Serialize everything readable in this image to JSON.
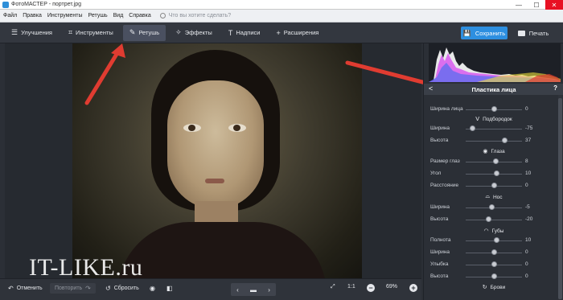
{
  "window": {
    "title": "ФотоМАСТЕР - портрет.jpg",
    "controls": [
      "—",
      "☐",
      "✕"
    ]
  },
  "menu": {
    "items": [
      "Файл",
      "Правка",
      "Инструменты",
      "Ретушь",
      "Вид",
      "Справка"
    ],
    "search_placeholder": "Что вы хотите сделать?"
  },
  "toolbar": {
    "tabs": [
      {
        "label": "Улучшения",
        "icon": "sliders-icon",
        "glyph": "☰",
        "active": false
      },
      {
        "label": "Инструменты",
        "icon": "crop-icon",
        "glyph": "⌗",
        "active": false
      },
      {
        "label": "Ретушь",
        "icon": "brush-icon",
        "glyph": "✎",
        "active": true
      },
      {
        "label": "Эффекты",
        "icon": "magic-wand-icon",
        "glyph": "✧",
        "active": false
      },
      {
        "label": "Надписи",
        "icon": "text-icon",
        "glyph": "T",
        "active": false
      },
      {
        "label": "Расширения",
        "icon": "plus-icon",
        "glyph": "+",
        "active": false
      }
    ],
    "save_label": "Сохранить",
    "print_label": "Печать"
  },
  "canvas": {
    "watermark": "IT-LIKE.ru"
  },
  "bottom": {
    "undo_label": "Отменить",
    "redo_label": "Повторить",
    "reset_label": "Сбросить",
    "zoom_ratio": "1:1",
    "zoom_percent": "69%"
  },
  "panel": {
    "title": "Пластика лица",
    "back_glyph": "<",
    "help_glyph": "?",
    "rows": [
      {
        "label": "Ширина лица",
        "value": "0",
        "level": 0.5
      },
      {
        "label": "Ширина",
        "value": "-75",
        "level": 0.12
      },
      {
        "label": "Высота",
        "value": "37",
        "level": 0.69
      },
      {
        "label": "Размер глаз",
        "value": "8",
        "level": 0.54
      },
      {
        "label": "Угол",
        "value": "10",
        "level": 0.55
      },
      {
        "label": "Расстояние",
        "value": "0",
        "level": 0.5
      },
      {
        "label": "Ширина",
        "value": "-5",
        "level": 0.47
      },
      {
        "label": "Высота",
        "value": "-20",
        "level": 0.4
      },
      {
        "label": "Полнота",
        "value": "10",
        "level": 0.55
      },
      {
        "label": "Ширина",
        "value": "0",
        "level": 0.5
      },
      {
        "label": "Улыбка",
        "value": "0",
        "level": 0.5
      },
      {
        "label": "Высота",
        "value": "0",
        "level": 0.5
      }
    ],
    "sections": {
      "chin": "Подбородок",
      "eyes": "Глаза",
      "nose": "Нос",
      "lips": "Губы",
      "brows": "Брови"
    }
  },
  "colors": {
    "accent": "#2d8fe0",
    "arrow": "#e03c31"
  }
}
